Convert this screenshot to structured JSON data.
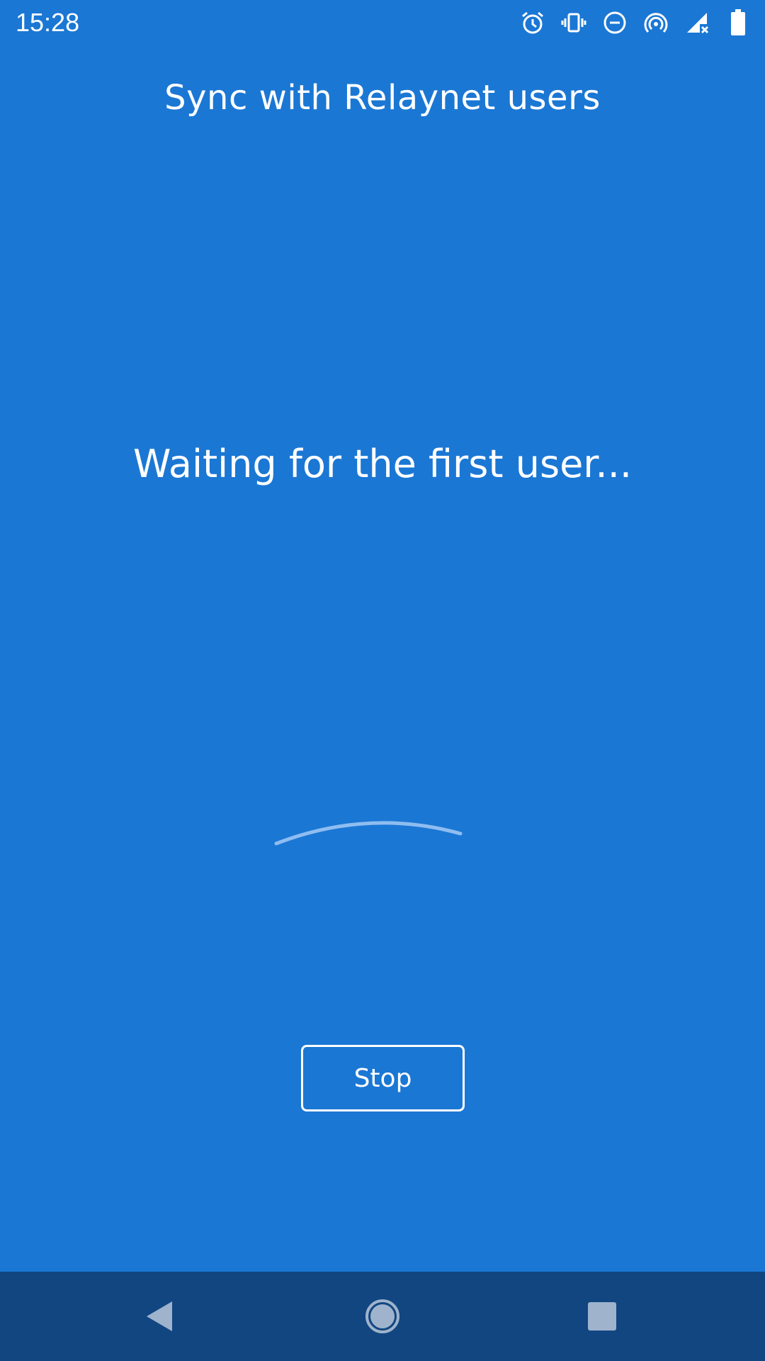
{
  "status_bar": {
    "time": "15:28",
    "icons": [
      "alarm-icon",
      "vibrate-icon",
      "do-not-disturb-icon",
      "hotspot-icon",
      "no-signal-icon",
      "battery-icon"
    ]
  },
  "header": {
    "title": "Sync with Relaynet users"
  },
  "main": {
    "status_text": "Waiting for the first user..."
  },
  "actions": {
    "stop_label": "Stop"
  },
  "nav_bar": {
    "icons": [
      "back-icon",
      "home-icon",
      "recents-icon"
    ]
  },
  "colors": {
    "background": "#1b77d4",
    "nav_bar": "#114681",
    "text": "#ffffff",
    "spinner": "#8fbdf0",
    "nav_icon": "#9fb3cc"
  }
}
